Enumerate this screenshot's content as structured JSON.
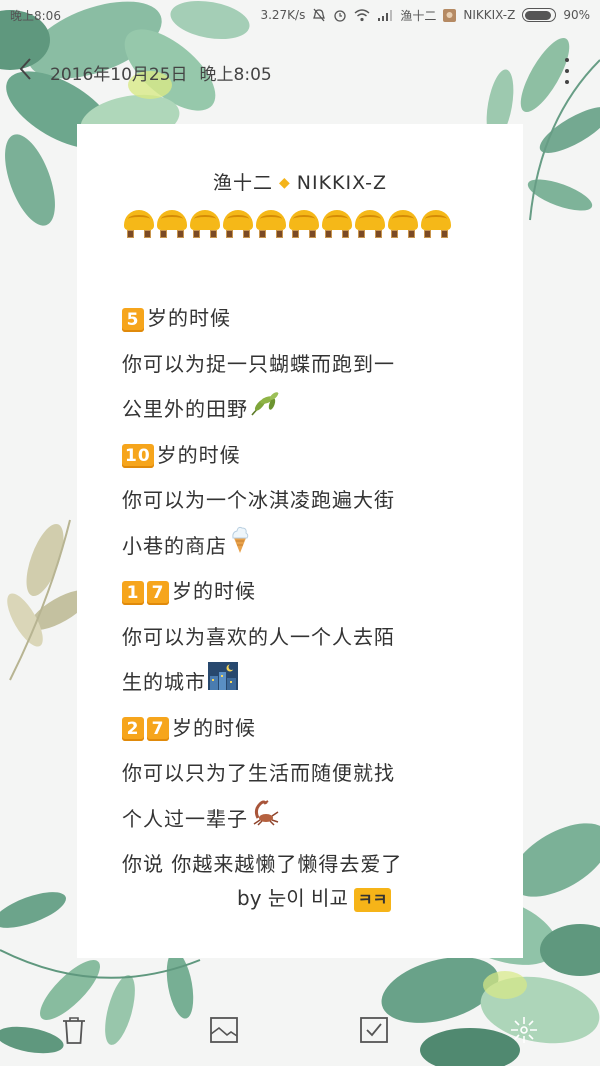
{
  "status_bar": {
    "time": "晚上8:06",
    "network_speed": "3.27K/s",
    "notification_text": "渔十二",
    "carrier_text": "NIKKIX-Z",
    "battery_level": 0.9,
    "battery_text": "90%",
    "icons": [
      "mute-icon",
      "alarm-icon",
      "wifi-icon",
      "signal-icon",
      "notification-avatar-icon",
      "battery-icon"
    ]
  },
  "header": {
    "date": "2016年10月25日",
    "time": "晚上8:05",
    "back_icon": "chevron-left-icon",
    "more_icon": "more-vertical-icon"
  },
  "note": {
    "title_left": "渔十二",
    "title_right": "NIKKIX-Z",
    "title_separator_icon": "diamond-icon",
    "emoji_row_count": 10,
    "emoji_row_icon": "tempura-bun-emoji",
    "lines": [
      {
        "badge": "5",
        "text": "岁的时候"
      },
      {
        "text": "你可以为捉一只蝴蝶而跑到一"
      },
      {
        "text": "公里外的田野",
        "emoji": "leaf-emoji"
      },
      {
        "badge": "10",
        "text": "岁的时候"
      },
      {
        "text": "你可以为一个冰淇凌跑遍大街"
      },
      {
        "text": "小巷的商店",
        "emoji": "ice-cream-emoji"
      },
      {
        "badge": "1 7",
        "text": "岁的时候"
      },
      {
        "text": "你可以为喜欢的人一个人去陌"
      },
      {
        "text": "生的城市",
        "emoji": "night-city-emoji"
      },
      {
        "badge": "2 7",
        "text": "岁的时候"
      },
      {
        "text": "你可以只为了生活而随便就找"
      },
      {
        "text": "个人过一辈子",
        "emoji": "scorpion-emoji"
      },
      {
        "text": "你说 你越来越懒了懒得去爱了"
      }
    ],
    "signature": "by 눈이 비교",
    "signature_badge": "ㅋㅋ"
  },
  "toolbar": {
    "items": [
      "delete-icon",
      "image-icon",
      "checklist-icon",
      "theme-icon"
    ]
  },
  "colors": {
    "accent": "#f6a51c",
    "background": "#f4f5f4",
    "card": "#ffffff",
    "leaf_green": "#6fae8e"
  }
}
